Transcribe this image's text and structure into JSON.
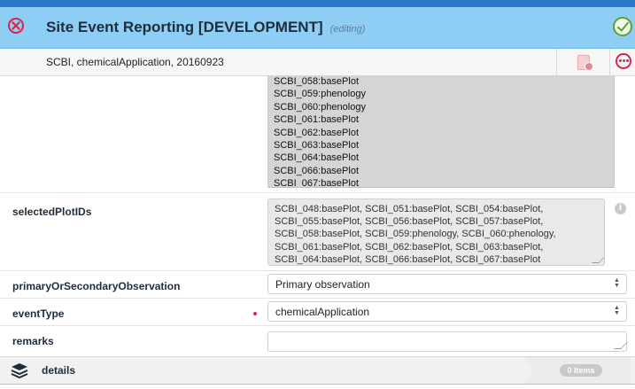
{
  "header": {
    "title": "Site Event Reporting [DEVELOPMENT]",
    "status": "(editing)"
  },
  "subheader": {
    "record": "SCBI, chemicalApplication, 20160923"
  },
  "plot_list": {
    "items": [
      "SCBI_058:basePlot",
      "SCBI_059:phenology",
      "SCBI_060:phenology",
      "SCBI_061:basePlot",
      "SCBI_062:basePlot",
      "SCBI_063:basePlot",
      "SCBI_064:basePlot",
      "SCBI_066:basePlot",
      "SCBI_067:basePlot"
    ]
  },
  "fields": {
    "selectedPlotIDs": {
      "label": "selectedPlotIDs",
      "lines": [
        "SCBI_048:basePlot, SCBI_051:basePlot, SCBI_054:basePlot,",
        "SCBI_055:basePlot, SCBI_056:basePlot, SCBI_057:basePlot,",
        "SCBI_058:basePlot, SCBI_059:phenology, SCBI_060:phenology,",
        "SCBI_061:basePlot, SCBI_062:basePlot, SCBI_063:basePlot,",
        "SCBI_064:basePlot, SCBI_066:basePlot, SCBI_067:basePlot"
      ]
    },
    "primaryOrSecondaryObservation": {
      "label": "primaryOrSecondaryObservation",
      "value": "Primary observation"
    },
    "eventType": {
      "label": "eventType",
      "value": "chemicalApplication"
    },
    "remarks": {
      "label": "remarks",
      "value": ""
    }
  },
  "details": {
    "label": "details",
    "count_badge": "0 Items"
  },
  "icons": {
    "close": "close-circle-icon",
    "save": "check-circle-icon",
    "document": "document-icon",
    "more": "more-options-icon",
    "info": "info-icon",
    "layers": "layers-icon"
  },
  "colors": {
    "header_bg": "#8ecdf4",
    "accent_red": "#e0224a",
    "accent_green": "#57a330"
  }
}
